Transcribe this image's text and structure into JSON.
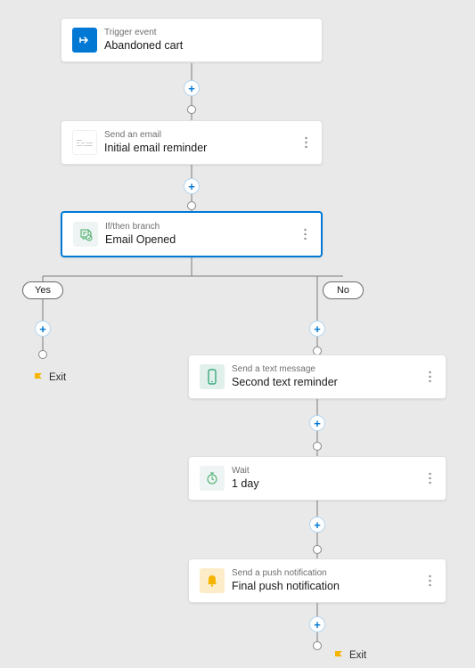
{
  "trigger": {
    "kicker": "Trigger event",
    "title": "Abandoned cart",
    "icon": "trigger-arrow-icon"
  },
  "email_node": {
    "kicker": "Send an email",
    "title": "Initial email reminder",
    "icon": "email-placeholder-icon"
  },
  "branch_node": {
    "kicker": "If/then branch",
    "title": "Email Opened",
    "icon": "branch-icon"
  },
  "branch": {
    "yes": "Yes",
    "no": "No"
  },
  "sms_node": {
    "kicker": "Send a text message",
    "title": "Second text reminder",
    "icon": "phone-icon"
  },
  "wait_node": {
    "kicker": "Wait",
    "title": "1 day",
    "icon": "timer-icon"
  },
  "push_node": {
    "kicker": "Send a push notification",
    "title": "Final push notification",
    "icon": "bell-icon"
  },
  "exit_label": "Exit",
  "colors": {
    "accent": "#0078d4",
    "amber": "#f5b400",
    "mint": "#e1f0ea",
    "bg": "#e9e9e9"
  }
}
